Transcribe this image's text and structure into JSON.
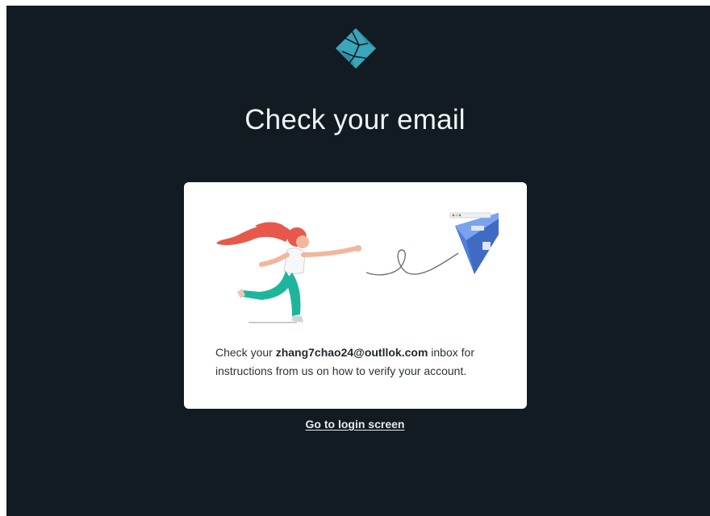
{
  "page": {
    "title": "Check your email"
  },
  "card": {
    "message_prefix": "Check your ",
    "email": "zhang7chao24@outllok.com",
    "message_suffix": " inbox for instructions from us on how to verify your account."
  },
  "footer": {
    "login_link": "Go to login screen"
  },
  "colors": {
    "background": "#111b21",
    "logo": "#3aa6b9",
    "card": "#ffffff",
    "plane": "#4f7fd8",
    "hair": "#e8584a",
    "pants": "#1fb59c"
  },
  "icons": {
    "logo": "netlify-logo",
    "illustration": "woman-throwing-paper-plane"
  }
}
